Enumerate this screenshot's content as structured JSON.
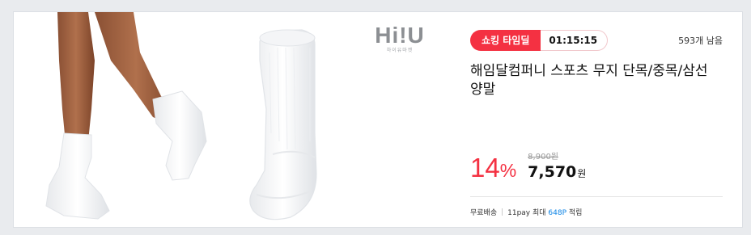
{
  "brand": {
    "logo_text": "Hi!U",
    "logo_subtext": "하이유마켓"
  },
  "deal": {
    "badge_label": "쇼킹 타임딜",
    "timer": "01:15:15",
    "remaining": "593개 남음"
  },
  "product": {
    "title": "해임달컴퍼니 스포츠 무지 단목/중목/삼선 양말",
    "image_alt": "white socks"
  },
  "price": {
    "discount_number": "14",
    "discount_symbol": "%",
    "original": "8,900원",
    "sale_amount": "7,570",
    "sale_unit": "원"
  },
  "footer": {
    "shipping": "무료배송",
    "pay_prefix": "11pay 최대 ",
    "pay_point": "648P",
    "pay_suffix": " 적립"
  },
  "colors": {
    "accent": "#f43142",
    "point": "#0b83e6",
    "background": "#e9ebee"
  }
}
